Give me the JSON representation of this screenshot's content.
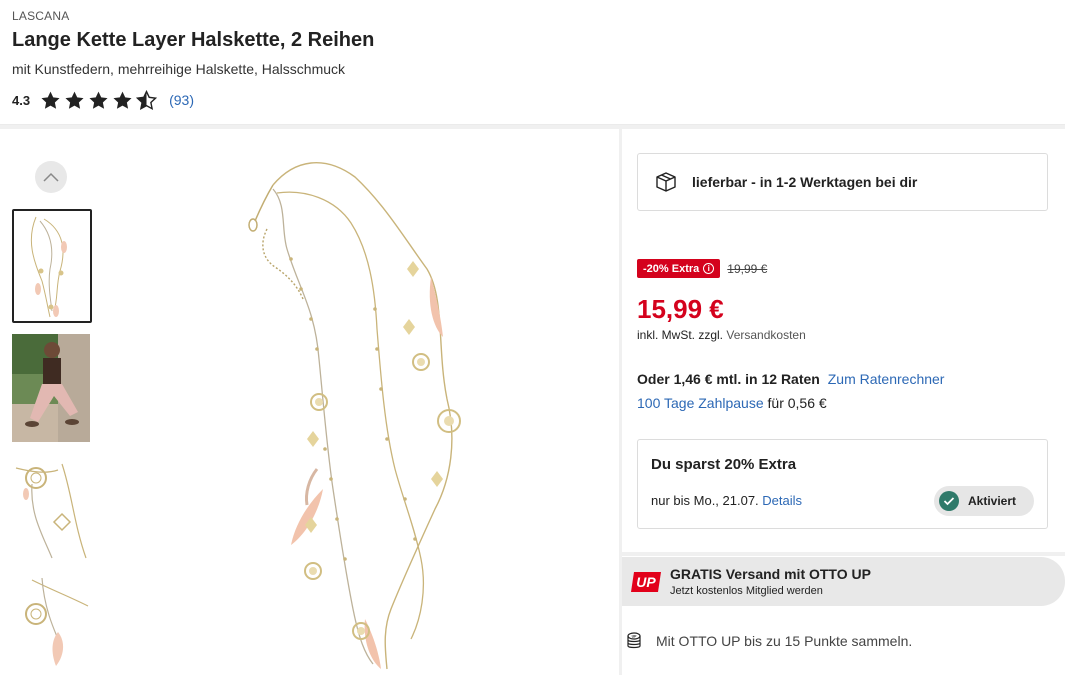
{
  "product": {
    "brand": "LASCANA",
    "title": "Lange Kette Layer Halskette, 2 Reihen",
    "subtitle": "mit Kunstfedern, mehrreihige Halskette, Halsschmuck",
    "rating_value": "4.3",
    "rating_stars": 4.3,
    "rating_count": "(93)"
  },
  "gallery": {
    "thumbnails": [
      "Halskette freigestellt",
      "Model trägt Halskette",
      "Detail Anhänger",
      "Detail Feder"
    ]
  },
  "delivery": {
    "icon": "package-icon",
    "text": "lieferbar - in 1-2 Werktagen bei dir"
  },
  "pricing": {
    "badge": "-20% Extra",
    "badge_icon": "ⓘ",
    "old_price": "19,99 €",
    "price": "15,99 €",
    "tax_prefix": "inkl. MwSt. zzgl.",
    "tax_link": "Versandkosten",
    "installment_text": "Oder 1,46 € mtl. in 12 Raten",
    "installment_link": "Zum Ratenrechner",
    "pause_link": "100 Tage Zahlpause",
    "pause_text": "für 0,56 €",
    "accent_color": "#d4021d"
  },
  "savings": {
    "title": "Du sparst 20% Extra",
    "until": "nur bis Mo., 21.07.",
    "details_link": "Details",
    "activated_label": "Aktiviert"
  },
  "otto_up": {
    "logo": "UP",
    "title": "GRATIS Versand mit OTTO UP",
    "subtitle": "Jetzt kostenlos Mitglied werden",
    "points_text": "Mit OTTO UP bis zu 15 Punkte sammeln."
  }
}
